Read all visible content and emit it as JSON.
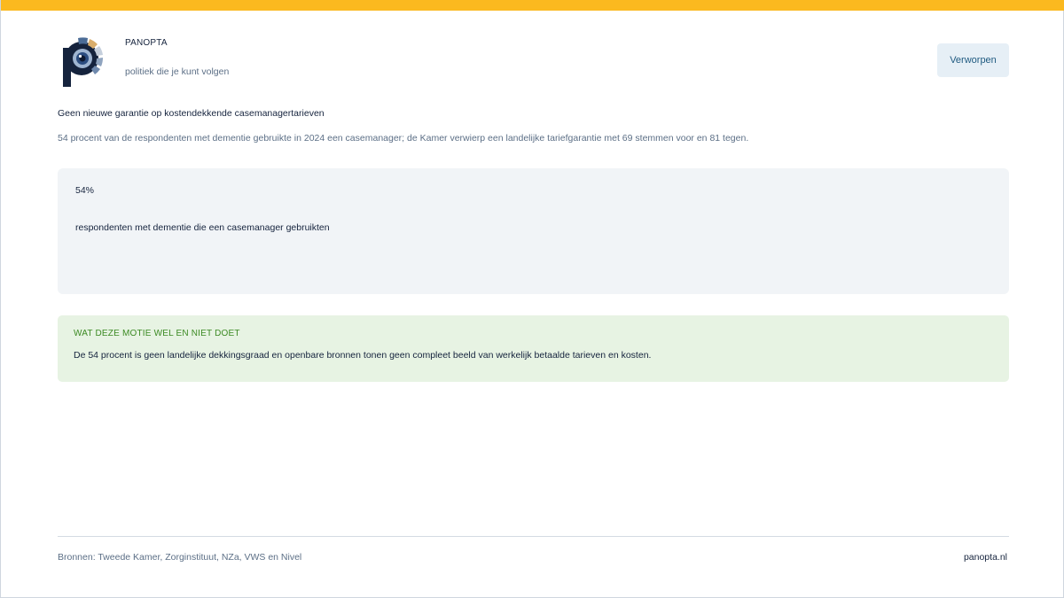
{
  "brand": {
    "name": "PANOPTA",
    "tagline": "politiek die je kunt volgen",
    "logo_icon": "panopta-eye-logo"
  },
  "status": {
    "label": "Verworpen"
  },
  "motion": {
    "title": "Geen nieuwe garantie op kostendekkende casemanagertarieven",
    "summary": "54 procent van de respondenten met dementie gebruikte in 2024 een casemanager; de Kamer verwierp een landelijke tariefgarantie met 69 stemmen voor en 81 tegen."
  },
  "stat": {
    "value": "54%",
    "label": "respondenten met dementie die een casemanager gebruikten"
  },
  "note": {
    "heading": "WAT DEZE MOTIE WEL EN NIET DOET",
    "body": "De 54 procent is geen landelijke dekkingsgraad en openbare bronnen tonen geen compleet beeld van werkelijk betaalde tarieven en kosten."
  },
  "footer": {
    "sources": "Bronnen: Tweede Kamer, Zorginstituut, NZa, VWS en Nivel",
    "site": "panopta.nl"
  },
  "colors": {
    "accent_bar": "#fbb91f",
    "navy": "#15233d",
    "muted": "#5c6f86",
    "status_bg": "#e6eff6",
    "stat_bg": "#f1f4f7",
    "note_bg": "#e7f3e3",
    "note_heading": "#3c8a23"
  }
}
